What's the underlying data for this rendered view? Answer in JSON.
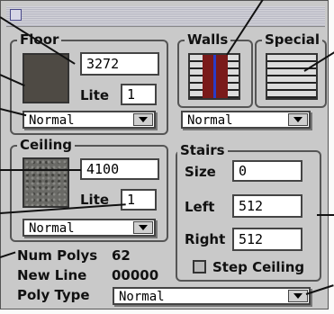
{
  "floor": {
    "title": "Floor",
    "height_value": "3272",
    "lite_label": "Lite",
    "lite_value": "1",
    "type_value": "Normal"
  },
  "walls": {
    "title": "Walls"
  },
  "special": {
    "title": "Special",
    "type_value": "Normal"
  },
  "ceiling": {
    "title": "Ceiling",
    "height_value": "4100",
    "lite_label": "Lite",
    "lite_value": "1",
    "type_value": "Normal"
  },
  "stairs": {
    "title": "Stairs",
    "size_label": "Size",
    "size_value": "0",
    "left_label": "Left",
    "left_value": "512",
    "right_label": "Right",
    "right_value": "512",
    "step_ceiling_label": "Step Ceiling",
    "step_ceiling_checked": false
  },
  "info": {
    "num_polys_label": "Num Polys",
    "num_polys_value": "62",
    "new_line_label": "New Line",
    "new_line_value": "00000"
  },
  "poly_type": {
    "label": "Poly Type",
    "value": "Normal"
  },
  "colors": {
    "panel": "#c9c9c9",
    "floor_swatch": "#4e4a44",
    "wall_accent": "#7a1a1a",
    "wall_line": "#2a3cc8"
  }
}
